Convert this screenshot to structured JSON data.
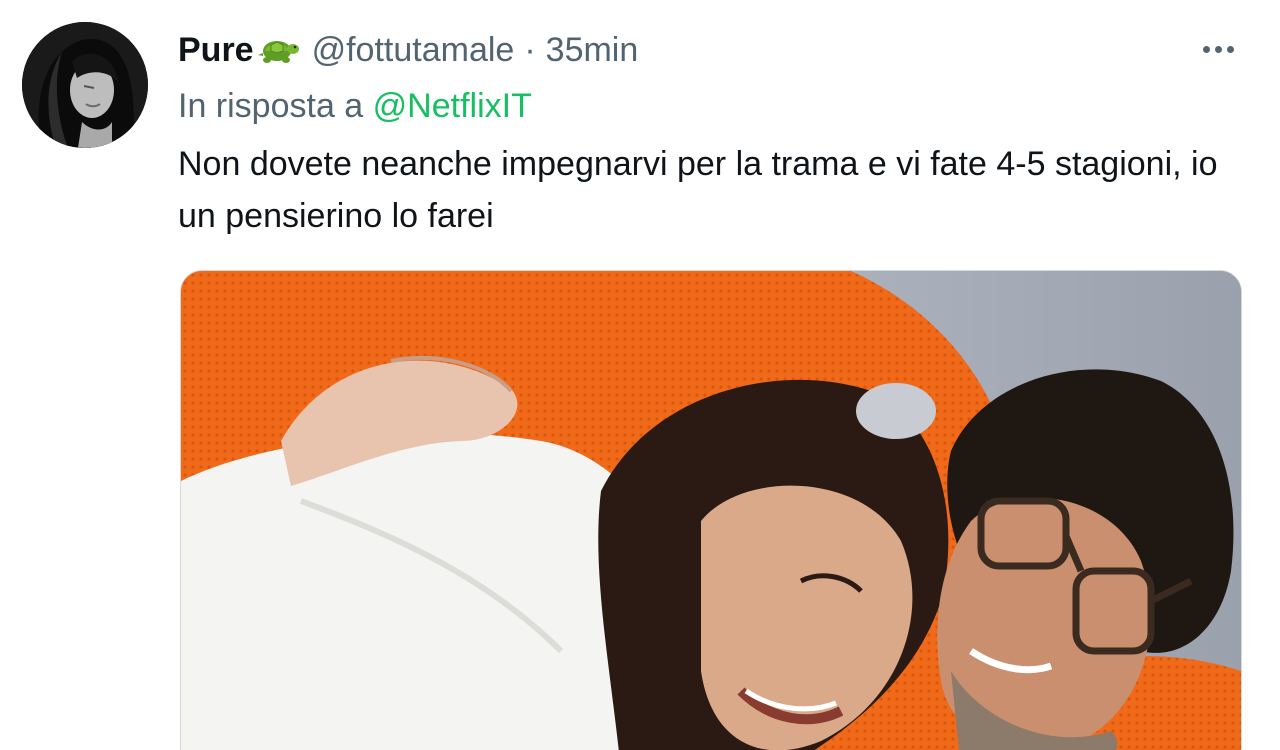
{
  "tweet": {
    "author": {
      "display_name": "Pure",
      "emoji_icon": "turtle-icon",
      "handle": "@fottutamale",
      "separator": "·",
      "time": "35min"
    },
    "reply_to": {
      "prefix": "In risposta a ",
      "mention": "@NetflixIT"
    },
    "text": "Non dovete neanche impegnarvi per la trama e vi fate 4-5 stagioni, io un pensierino lo farei",
    "more_icon": "more-horizontal-icon",
    "media": {
      "type": "photo"
    }
  },
  "colors": {
    "text_primary": "#0f1419",
    "text_secondary": "#536471",
    "mention": "#17bf63",
    "sofa_orange": "#f26a1b"
  }
}
